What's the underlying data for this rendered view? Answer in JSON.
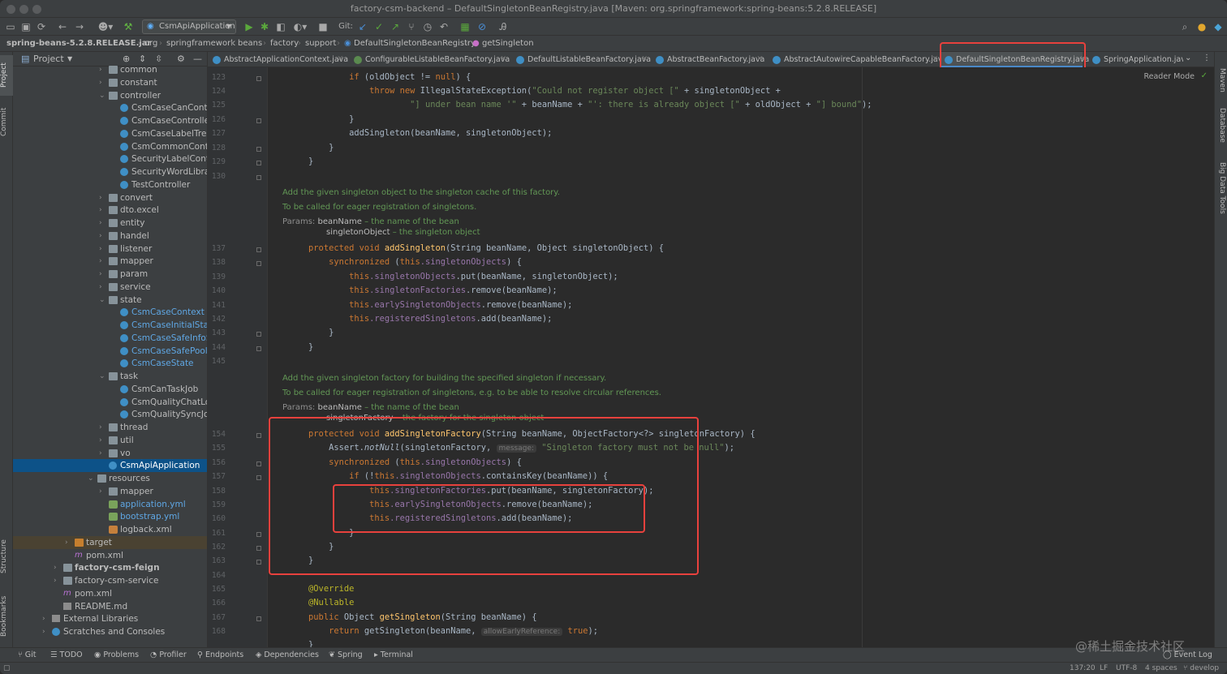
{
  "window": {
    "title": "factory-csm-backend – DefaultSingletonBeanRegistry.java [Maven: org.springframework:spring-beans:5.2.8.RELEASE]"
  },
  "toolbar": {
    "run_config": "CsmApiApplication",
    "git_label": "Git:"
  },
  "breadcrumb": {
    "items": [
      "spring-beans-5.2.8.RELEASE.jar",
      "org",
      "springframework",
      "beans",
      "factory",
      "support",
      "DefaultSingletonBeanRegistry",
      "getSingleton"
    ]
  },
  "left_strip": {
    "project": "Project",
    "commit": "Commit",
    "structure": "Structure",
    "bookmarks": "Bookmarks"
  },
  "project_panel": {
    "title": "Project",
    "tree": [
      {
        "label": "common",
        "type": "folder",
        "indent": 1,
        "arrow": ">"
      },
      {
        "label": "constant",
        "type": "folder",
        "indent": 1,
        "arrow": ">"
      },
      {
        "label": "controller",
        "type": "folder",
        "indent": 1,
        "arrow": "v"
      },
      {
        "label": "CsmCaseCanController",
        "type": "class",
        "indent": 2
      },
      {
        "label": "CsmCaseController",
        "type": "class",
        "indent": 2
      },
      {
        "label": "CsmCaseLabelTreeCo",
        "type": "class",
        "indent": 2
      },
      {
        "label": "CsmCommonControlle",
        "type": "class",
        "indent": 2
      },
      {
        "label": "SecurityLabelControlle",
        "type": "class",
        "indent": 2
      },
      {
        "label": "SecurityWordLibraryC",
        "type": "class",
        "indent": 2
      },
      {
        "label": "TestController",
        "type": "class",
        "indent": 2
      },
      {
        "label": "convert",
        "type": "folder",
        "indent": 1,
        "arrow": ">"
      },
      {
        "label": "dto.excel",
        "type": "folder",
        "indent": 1,
        "arrow": ">"
      },
      {
        "label": "entity",
        "type": "folder",
        "indent": 1,
        "arrow": ">"
      },
      {
        "label": "handel",
        "type": "folder",
        "indent": 1,
        "arrow": ">"
      },
      {
        "label": "listener",
        "type": "folder",
        "indent": 1,
        "arrow": ">"
      },
      {
        "label": "mapper",
        "type": "folder",
        "indent": 1,
        "arrow": ">"
      },
      {
        "label": "param",
        "type": "folder",
        "indent": 1,
        "arrow": ">"
      },
      {
        "label": "service",
        "type": "folder",
        "indent": 1,
        "arrow": ">"
      },
      {
        "label": "state",
        "type": "folder",
        "indent": 1,
        "arrow": "v"
      },
      {
        "label": "CsmCaseContext",
        "type": "class",
        "indent": 2,
        "blue": true
      },
      {
        "label": "CsmCaseInitialState",
        "type": "class",
        "indent": 2,
        "blue": true
      },
      {
        "label": "CsmCaseSafeInfoState",
        "type": "class",
        "indent": 2,
        "blue": true
      },
      {
        "label": "CsmCaseSafePoolStat",
        "type": "class",
        "indent": 2,
        "blue": true
      },
      {
        "label": "CsmCaseState",
        "type": "class",
        "indent": 2,
        "blue": true
      },
      {
        "label": "task",
        "type": "folder",
        "indent": 1,
        "arrow": "v"
      },
      {
        "label": "CsmCanTaskJob",
        "type": "class",
        "indent": 2
      },
      {
        "label": "CsmQualityChatLogJo",
        "type": "class",
        "indent": 2
      },
      {
        "label": "CsmQualitySyncJob",
        "type": "class",
        "indent": 2
      },
      {
        "label": "thread",
        "type": "folder",
        "indent": 1,
        "arrow": ">"
      },
      {
        "label": "util",
        "type": "folder",
        "indent": 1,
        "arrow": ">"
      },
      {
        "label": "vo",
        "type": "folder",
        "indent": 1,
        "arrow": ">"
      },
      {
        "label": "CsmApiApplication",
        "type": "class",
        "indent": 1,
        "selected": true
      },
      {
        "label": "resources",
        "type": "folder",
        "indent": 0,
        "arrow": "v"
      },
      {
        "label": "mapper",
        "type": "folder",
        "indent": 1,
        "arrow": ">"
      },
      {
        "label": "application.yml",
        "type": "yml",
        "indent": 1,
        "blue": true
      },
      {
        "label": "bootstrap.yml",
        "type": "yml",
        "indent": 1,
        "blue": true
      },
      {
        "label": "logback.xml",
        "type": "xml",
        "indent": 1
      },
      {
        "label": "target",
        "type": "folder-orange",
        "indent": -2,
        "arrow": ">",
        "hl": true
      },
      {
        "label": "pom.xml",
        "type": "maven",
        "indent": -2
      },
      {
        "label": "factory-csm-feign",
        "type": "folder",
        "indent": -3,
        "arrow": ">",
        "bold": true
      },
      {
        "label": "factory-csm-service",
        "type": "folder",
        "indent": -3,
        "arrow": ">"
      },
      {
        "label": "pom.xml",
        "type": "maven",
        "indent": -3
      },
      {
        "label": "README.md",
        "type": "md",
        "indent": -3
      },
      {
        "label": "External Libraries",
        "type": "lib",
        "indent": -4,
        "arrow": ">"
      },
      {
        "label": "Scratches and Consoles",
        "type": "scratch",
        "indent": -4,
        "arrow": ">"
      }
    ]
  },
  "tabs": [
    {
      "label": "AbstractApplicationContext.java"
    },
    {
      "label": "ConfigurableListableBeanFactory.java"
    },
    {
      "label": "DefaultListableBeanFactory.java"
    },
    {
      "label": "AbstractBeanFactory.java"
    },
    {
      "label": "AbstractAutowireCapableBeanFactory.java"
    },
    {
      "label": "DefaultSingletonBeanRegistry.java",
      "active": true
    },
    {
      "label": "SpringApplication.java"
    }
  ],
  "editor": {
    "reader_mode": "Reader Mode",
    "line_numbers": [
      "123",
      "124",
      "125",
      "126",
      "127",
      "128",
      "129",
      "130",
      "137",
      "138",
      "139",
      "140",
      "141",
      "142",
      "143",
      "144",
      "145",
      "154",
      "155",
      "156",
      "157",
      "158",
      "159",
      "160",
      "161",
      "162",
      "163",
      "164",
      "165",
      "166",
      "167",
      "168"
    ],
    "code": {
      "l123_kw": "if",
      "l123_rest": " (oldObject != ",
      "l123_null": "null",
      "l123_end": ") {",
      "l124_throw": "throw new",
      "l124_cls": " IllegalStateException(",
      "l124_str": "\"Could not register object [\"",
      "l124_end": " + singletonObject +",
      "l125_str1": "\"] under bean name '\"",
      "l125_mid": " + beanName + ",
      "l125_str2": "\"': there is already object [\"",
      "l125_mid2": " + oldObject + ",
      "l125_str3": "\"] bound\"",
      "l125_end": ");",
      "l126": "}",
      "l127_fn": "addSingleton",
      "l127_end": "(beanName, singletonObject);",
      "l128": "}",
      "l129": "}",
      "doc1_1": "Add the given singleton object to the singleton cache of this factory.",
      "doc1_2": "To be called for eager registration of singletons.",
      "doc1_params": "Params:",
      "doc1_p1": "beanName",
      "doc1_p1d": " – the name of the bean",
      "doc1_p2": "singletonObject",
      "doc1_p2d": " – the singleton object",
      "l137_kw": "protected void",
      "l137_fn": "addSingleton",
      "l137_end": "(String beanName, Object singletonObject) {",
      "l138_kw": "synchronized",
      "l138_a": " (",
      "l138_this": "this",
      "l138_f": ".singletonObjects",
      "l138_end": ") {",
      "l139_this": "this",
      "l139_f": ".singletonObjects",
      "l139_end": ".put(beanName, singletonObject);",
      "l140_this": "this",
      "l140_f": ".singletonFactories",
      "l140_end": ".remove(beanName);",
      "l141_this": "this",
      "l141_f": ".earlySingletonObjects",
      "l141_end": ".remove(beanName);",
      "l142_this": "this",
      "l142_f": ".registeredSingletons",
      "l142_end": ".add(beanName);",
      "l143": "}",
      "l144": "}",
      "doc2_1": "Add the given singleton factory for building the specified singleton if necessary.",
      "doc2_2": "To be called for eager registration of singletons, e.g. to be able to resolve circular references.",
      "doc2_params": "Params:",
      "doc2_p1": "beanName",
      "doc2_p1d": " – the name of the bean",
      "doc2_p2": "singletonFactory",
      "doc2_p2d": " – the factory for the singleton object",
      "l154_kw": "protected void",
      "l154_fn": "addSingletonFactory",
      "l154_end": "(String beanName, ObjectFactory<?> singletonFactory) {",
      "l155_a": "Assert.",
      "l155_m": "notNull",
      "l155_b": "(singletonFactory, ",
      "l155_hint": "message:",
      "l155_str": "\"Singleton factory must not be null\"",
      "l155_end": ");",
      "l156_kw": "synchronized",
      "l156_a": " (",
      "l156_this": "this",
      "l156_f": ".singletonObjects",
      "l156_end": ") {",
      "l157_kw": "if",
      "l157_a": " (!",
      "l157_this": "this",
      "l157_f": ".singletonObjects",
      "l157_end": ".containsKey(beanName)) {",
      "l158_this": "this",
      "l158_f": ".singletonFactories",
      "l158_end": ".put(beanName, singletonFactory);",
      "l159_this": "this",
      "l159_f": ".earlySingletonObjects",
      "l159_end": ".remove(beanName);",
      "l160_this": "this",
      "l160_f": ".registeredSingletons",
      "l160_end": ".add(beanName);",
      "l161": "}",
      "l162": "}",
      "l163": "}",
      "l165": "@Override",
      "l166": "@Nullable",
      "l167_kw": "public",
      "l167_a": " Object ",
      "l167_fn": "getSingleton",
      "l167_end": "(String beanName) {",
      "l168_kw": "return",
      "l168_a": " getSingleton(beanName, ",
      "l168_hint": "allowEarlyReference:",
      "l168_true": "true",
      "l168_end": ");"
    }
  },
  "right_strip": {
    "maven": "Maven",
    "database": "Database",
    "bigdata": "Big Data Tools"
  },
  "bottom_tools": [
    "Git",
    "TODO",
    "Problems",
    "Profiler",
    "Endpoints",
    "Dependencies",
    "Spring",
    "Terminal"
  ],
  "event_log": "Event Log",
  "status": {
    "position": "137:20",
    "line_sep": "LF",
    "encoding": "UTF-8",
    "indent": "4 spaces",
    "branch": "develop"
  },
  "watermark": "@稀土掘金技术社区",
  "colors": {
    "highlight_box": "#e8413d",
    "selection": "#0d5288",
    "accent": "#4a88c7"
  }
}
